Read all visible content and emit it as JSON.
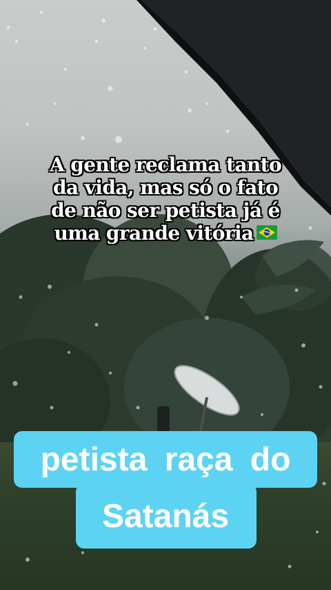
{
  "caption": {
    "line1": "A gente reclama tanto",
    "line2": "da vida, mas só o fato",
    "line3": "de não ser petista já é",
    "line4": "uma grande vitória"
  },
  "icons": {
    "flag": "brazil-flag-icon"
  },
  "banner": {
    "line1": "petista  raça  do",
    "line2": "Satanás"
  },
  "colors": {
    "banner_bg": "#5dd3f3",
    "caption_text": "#ffffff",
    "caption_outline": "#000000"
  }
}
